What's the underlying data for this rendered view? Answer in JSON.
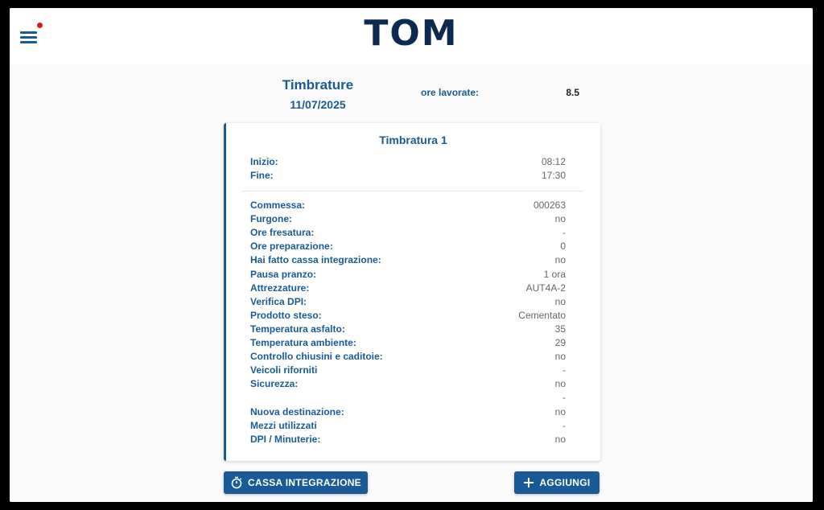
{
  "header": {
    "logo_text": "TOM",
    "menu_icon": "hamburger-icon",
    "notification_color": "#d21f1f"
  },
  "page": {
    "title": "Timbrature",
    "date": "11/07/2025",
    "hours_label": "ore lavorate:",
    "hours_value": "8.5"
  },
  "card": {
    "title": "Timbratura 1",
    "time_rows": [
      {
        "label": "Inizio:",
        "value": "08:12"
      },
      {
        "label": "Fine:",
        "value": "17:30"
      }
    ],
    "detail_rows": [
      {
        "label": "Commessa:",
        "value": "000263"
      },
      {
        "label": "Furgone:",
        "value": "no"
      },
      {
        "label": "Ore fresatura:",
        "value": "-"
      },
      {
        "label": "Ore preparazione:",
        "value": "0"
      },
      {
        "label": "Hai fatto cassa integrazione:",
        "value": "no"
      },
      {
        "label": "Pausa pranzo:",
        "value": "1 ora"
      },
      {
        "label": "Attrezzature:",
        "value": "AUT4A-2"
      },
      {
        "label": "Verifica DPI:",
        "value": "no"
      },
      {
        "label": "Prodotto steso:",
        "value": "Cementato"
      },
      {
        "label": "Temperatura asfalto:",
        "value": "35"
      },
      {
        "label": "Temperatura ambiente:",
        "value": "29"
      },
      {
        "label": "Controllo chiusini e caditoie:",
        "value": "no"
      },
      {
        "label": "Veicoli riforniti",
        "value": "-"
      },
      {
        "label": "Sicurezza:",
        "value": "no"
      },
      {
        "label": "",
        "value": "-"
      },
      {
        "label": "Nuova destinazione:",
        "value": "no"
      },
      {
        "label": "Mezzi utilizzati",
        "value": "-"
      },
      {
        "label": "DPI / Minuterie:",
        "value": "no"
      }
    ]
  },
  "buttons": {
    "cassa_label": "CASSA INTEGRAZIONE",
    "cassa_icon": "timer-icon",
    "add_label": "AGGIUNGI",
    "add_icon": "plus-icon"
  },
  "colors": {
    "primary": "#1a5a96",
    "logo": "#0c2a4f"
  }
}
